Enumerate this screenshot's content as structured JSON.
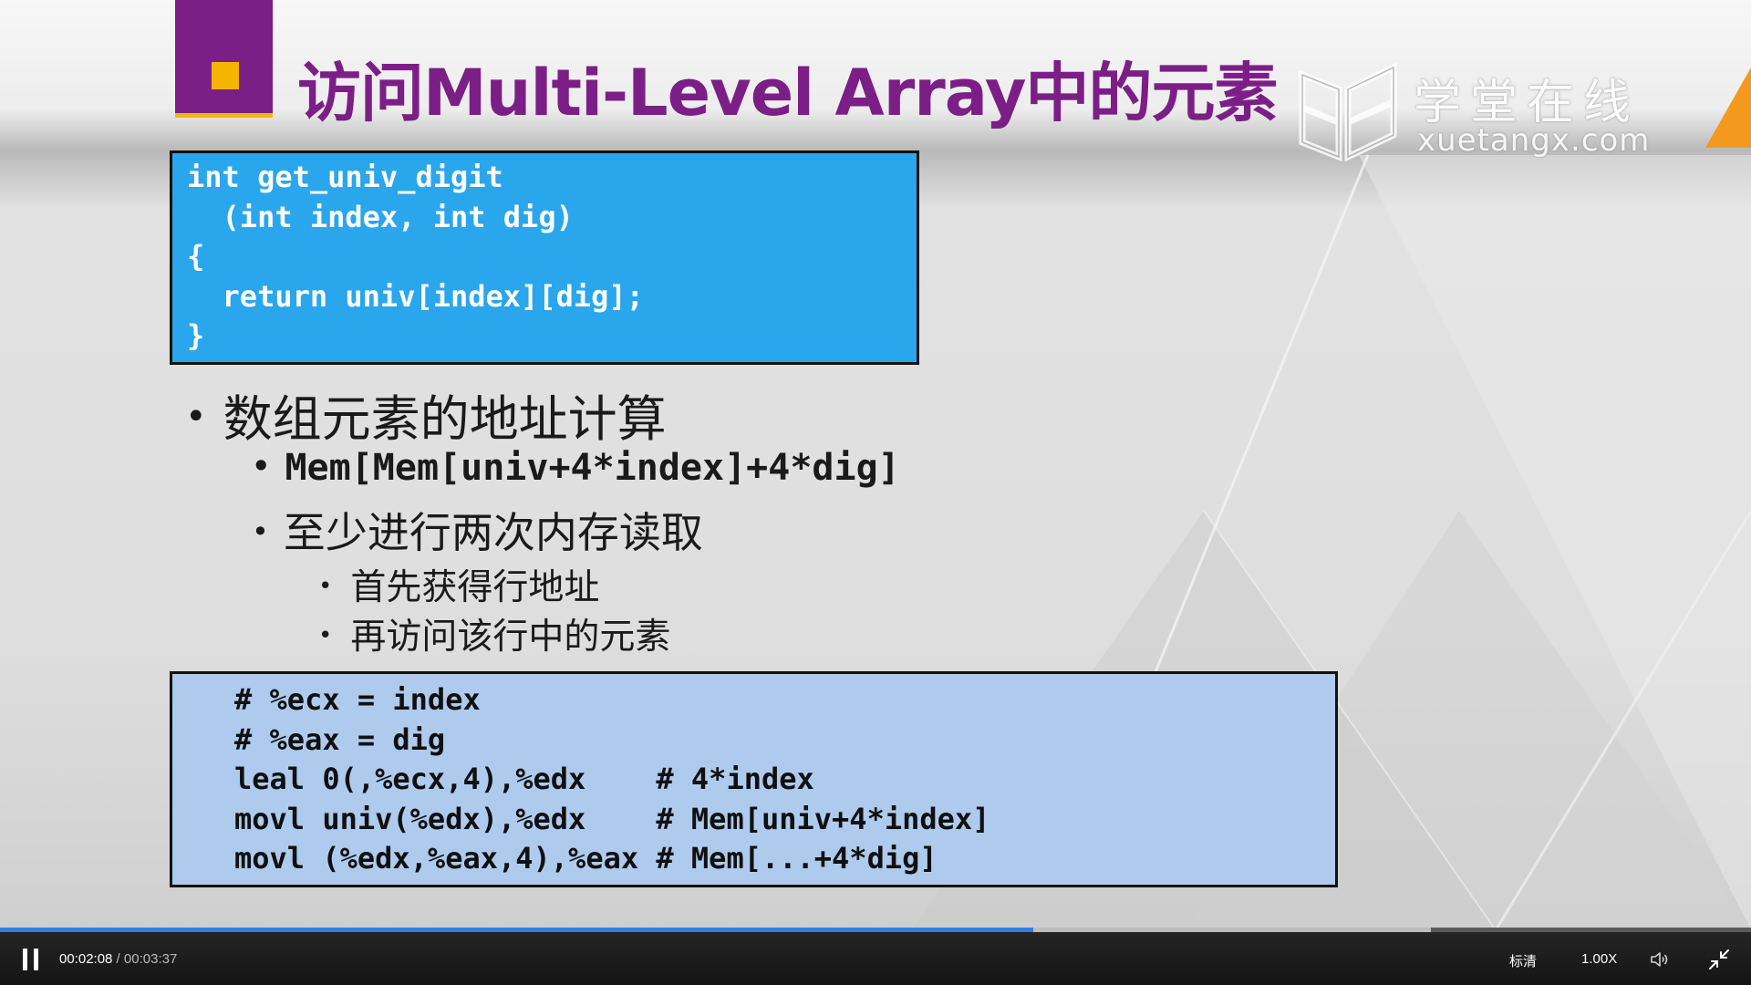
{
  "slide": {
    "title": "访问Multi-Level Array中的元素",
    "watermark": {
      "brand_cn": "学堂在线",
      "url": "xuetangx.com"
    },
    "code_top": "int get_univ_digit\n  (int index, int dig)\n{\n  return univ[index][dig];\n}",
    "bullets": [
      {
        "level": 1,
        "text": "数组元素的地址计算"
      },
      {
        "level": 2,
        "text": "Mem[Mem[univ+4*index]+4*dig]"
      },
      {
        "level": 2,
        "text": "至少进行两次内存读取"
      },
      {
        "level": 3,
        "text": "首先获得行地址"
      },
      {
        "level": 3,
        "text": "再访问该行中的元素"
      }
    ],
    "code_bottom": "# %ecx = index\n# %eax = dig\nleal 0(,%ecx,4),%edx    # 4*index\nmovl univ(%edx),%edx    # Mem[univ+4*index]\nmovl (%edx,%eax,4),%eax # Mem[...+4*dig]",
    "colors": {
      "title": "#7b1f86",
      "accent_square": "#f4b400",
      "code_top_bg": "#2aa6ec",
      "code_bottom_bg": "#aecbee"
    }
  },
  "player": {
    "state": "playing",
    "current_time": "00:02:08",
    "separator": " / ",
    "total_time": "00:03:37",
    "played_fraction": 0.59,
    "buffered_fraction": 0.817,
    "quality_label": "标清",
    "speed_label": "1.00X",
    "icons": {
      "play_pause": "pause-icon",
      "volume": "volume-icon",
      "fullscreen": "exit-fullscreen-icon"
    },
    "colors": {
      "progress": "#2e7fe0",
      "buffered": "#bdbdbd"
    }
  }
}
